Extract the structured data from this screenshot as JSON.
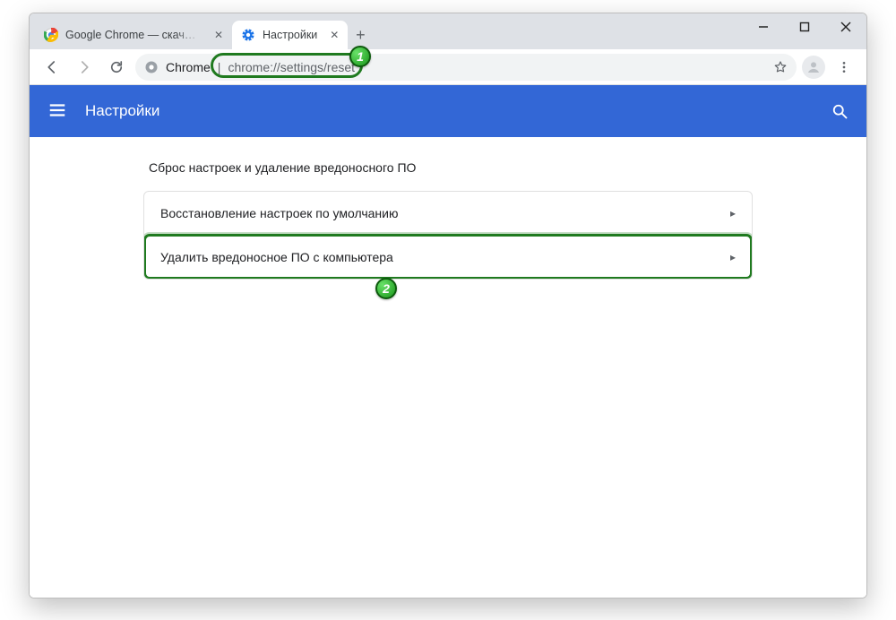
{
  "tabs": {
    "inactive": {
      "label": "Google Chrome — скачать бесп"
    },
    "active": {
      "label": "Настройки"
    }
  },
  "omnibox": {
    "host": "Chrome",
    "sep": " | ",
    "url": "chrome://settings/reset"
  },
  "appbar": {
    "title": "Настройки"
  },
  "section": {
    "title": "Сброс настроек и удаление вредоносного ПО",
    "rows": [
      {
        "label": "Восстановление настроек по умолчанию"
      },
      {
        "label": "Удалить вредоносное ПО с компьютера"
      }
    ]
  },
  "badges": {
    "b1": "1",
    "b2": "2"
  },
  "annotation_color": "#1f7a1f"
}
